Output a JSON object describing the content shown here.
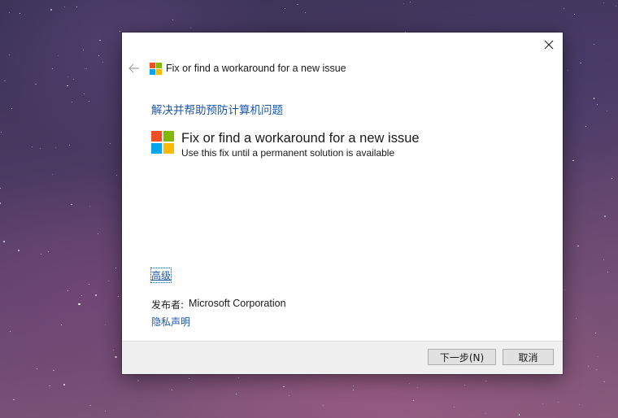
{
  "window": {
    "title": "Fix or find a workaround for a new issue",
    "close_icon": "close-icon",
    "back_icon": "back-arrow-icon"
  },
  "content": {
    "heading": "解决并帮助预防计算机问题",
    "item_title": "Fix or find a workaround for a new issue",
    "item_subtitle": "Use this fix until a permanent solution is available",
    "advanced_link": "高级",
    "publisher_label": "发布者:",
    "publisher_name": "Microsoft Corporation",
    "privacy_link": "隐私声明"
  },
  "footer": {
    "next_label": "下一步(N)",
    "cancel_label": "取消"
  },
  "colors": {
    "link": "#1e56a8",
    "logo_red": "#f25022",
    "logo_green": "#7fba00",
    "logo_blue": "#00a4ef",
    "logo_yellow": "#ffb900"
  }
}
